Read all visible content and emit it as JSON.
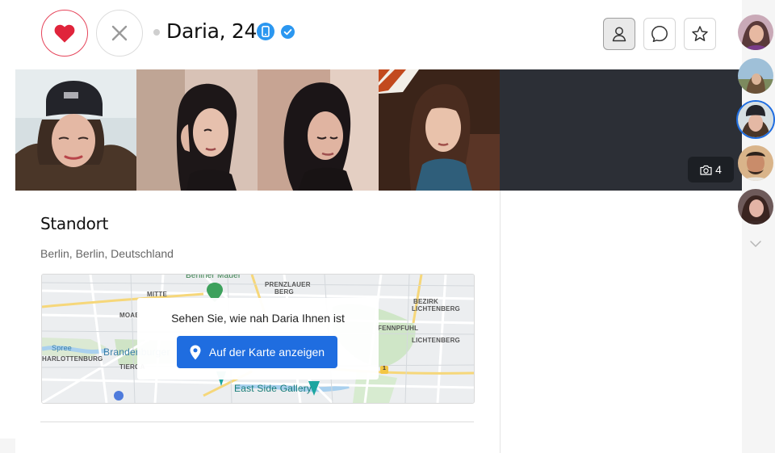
{
  "profile": {
    "name_age": "Daria, 24",
    "phone_verified_icon": "phone-icon",
    "verified_icon": "verified-check-icon"
  },
  "actions": {
    "like_icon": "heart-icon",
    "dislike_icon": "close-icon",
    "profile_icon": "person-icon",
    "chat_icon": "chat-bubble-icon",
    "favorite_icon": "star-icon"
  },
  "gallery": {
    "photo_count": "4",
    "camera_icon": "camera-icon"
  },
  "location_section": {
    "title": "Standort",
    "location": "Berlin, Berlin, Deutschland",
    "map_prompt": "Sehen Sie, wie nah Daria Ihnen ist",
    "map_button": "Auf der Karte anzeigen",
    "map_labels": {
      "mauer": "Berliner Mauer",
      "mitte": "MITTE",
      "prenzlauer": "PRENZLAUER",
      "berg": "BERG",
      "bezirk": "BEZIRK",
      "lichtenberg_top": "LICHTENBERG",
      "moab": "MOAB",
      "fennpfuhl": "FENNPFUHL",
      "spree": "Spree",
      "charlottenburg": "HARLOTTENBURG",
      "brandenburger": "Brandenburger",
      "lichtenberg": "LICHTENBERG",
      "tiergarten": "TIERGA",
      "east_side_gallery": "East Side Gallery",
      "route": "1"
    }
  },
  "colors": {
    "accent": "#1f6de0",
    "like": "#e6455b",
    "verified": "#2b97f0"
  }
}
